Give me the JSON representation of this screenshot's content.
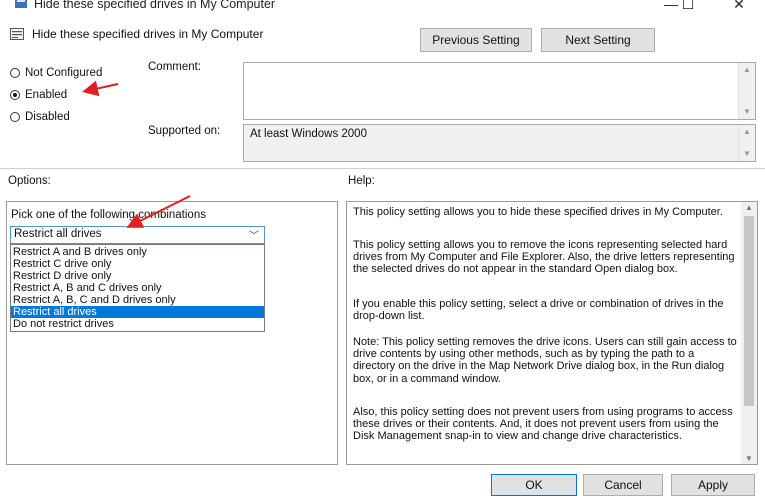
{
  "window": {
    "title": "Hide these specified drives in My Computer",
    "minimize": "—",
    "maximize": "☐",
    "close": "✕"
  },
  "header": {
    "policy_title": "Hide these specified drives in My Computer",
    "previous_button": "Previous Setting",
    "next_button": "Next Setting"
  },
  "state": {
    "options": [
      {
        "label": "Not Configured",
        "selected": false
      },
      {
        "label": "Enabled",
        "selected": true
      },
      {
        "label": "Disabled",
        "selected": false
      }
    ]
  },
  "comment": {
    "label": "Comment:",
    "value": ""
  },
  "supported": {
    "label": "Supported on:",
    "value": "At least Windows 2000"
  },
  "options_section": {
    "label": "Options:",
    "prompt": "Pick one of the following combinations",
    "selected_value": "Restrict all drives",
    "dropdown_items": [
      "Restrict A and B drives only",
      "Restrict C drive only",
      "Restrict D drive only",
      "Restrict A, B and C drives only",
      "Restrict A, B, C and D drives only",
      "Restrict all drives",
      "Do not restrict drives"
    ],
    "highlighted_index": 5
  },
  "help_section": {
    "label": "Help:",
    "paragraphs": [
      "This policy setting allows you to hide these specified drives in My Computer.",
      "This policy setting allows you to remove the icons representing selected hard drives from My Computer and File Explorer. Also, the drive letters representing the selected drives do not appear in the standard Open dialog box.",
      "If you enable this policy setting, select a drive or combination of drives in the drop-down list.",
      "Note: This policy setting removes the drive icons. Users can still gain access to drive contents by using other methods, such as by typing the path to a directory on the drive in the Map Network Drive dialog box, in the Run dialog box, or in a command window.",
      "Also, this policy setting does not prevent users from using programs to access these drives or their contents. And, it does not prevent users from using the Disk Management snap-in to view and change drive characteristics."
    ]
  },
  "footer": {
    "ok": "OK",
    "cancel": "Cancel",
    "apply": "Apply"
  },
  "colors": {
    "annotation_arrow": "#e02020",
    "selection": "#0078d7"
  }
}
